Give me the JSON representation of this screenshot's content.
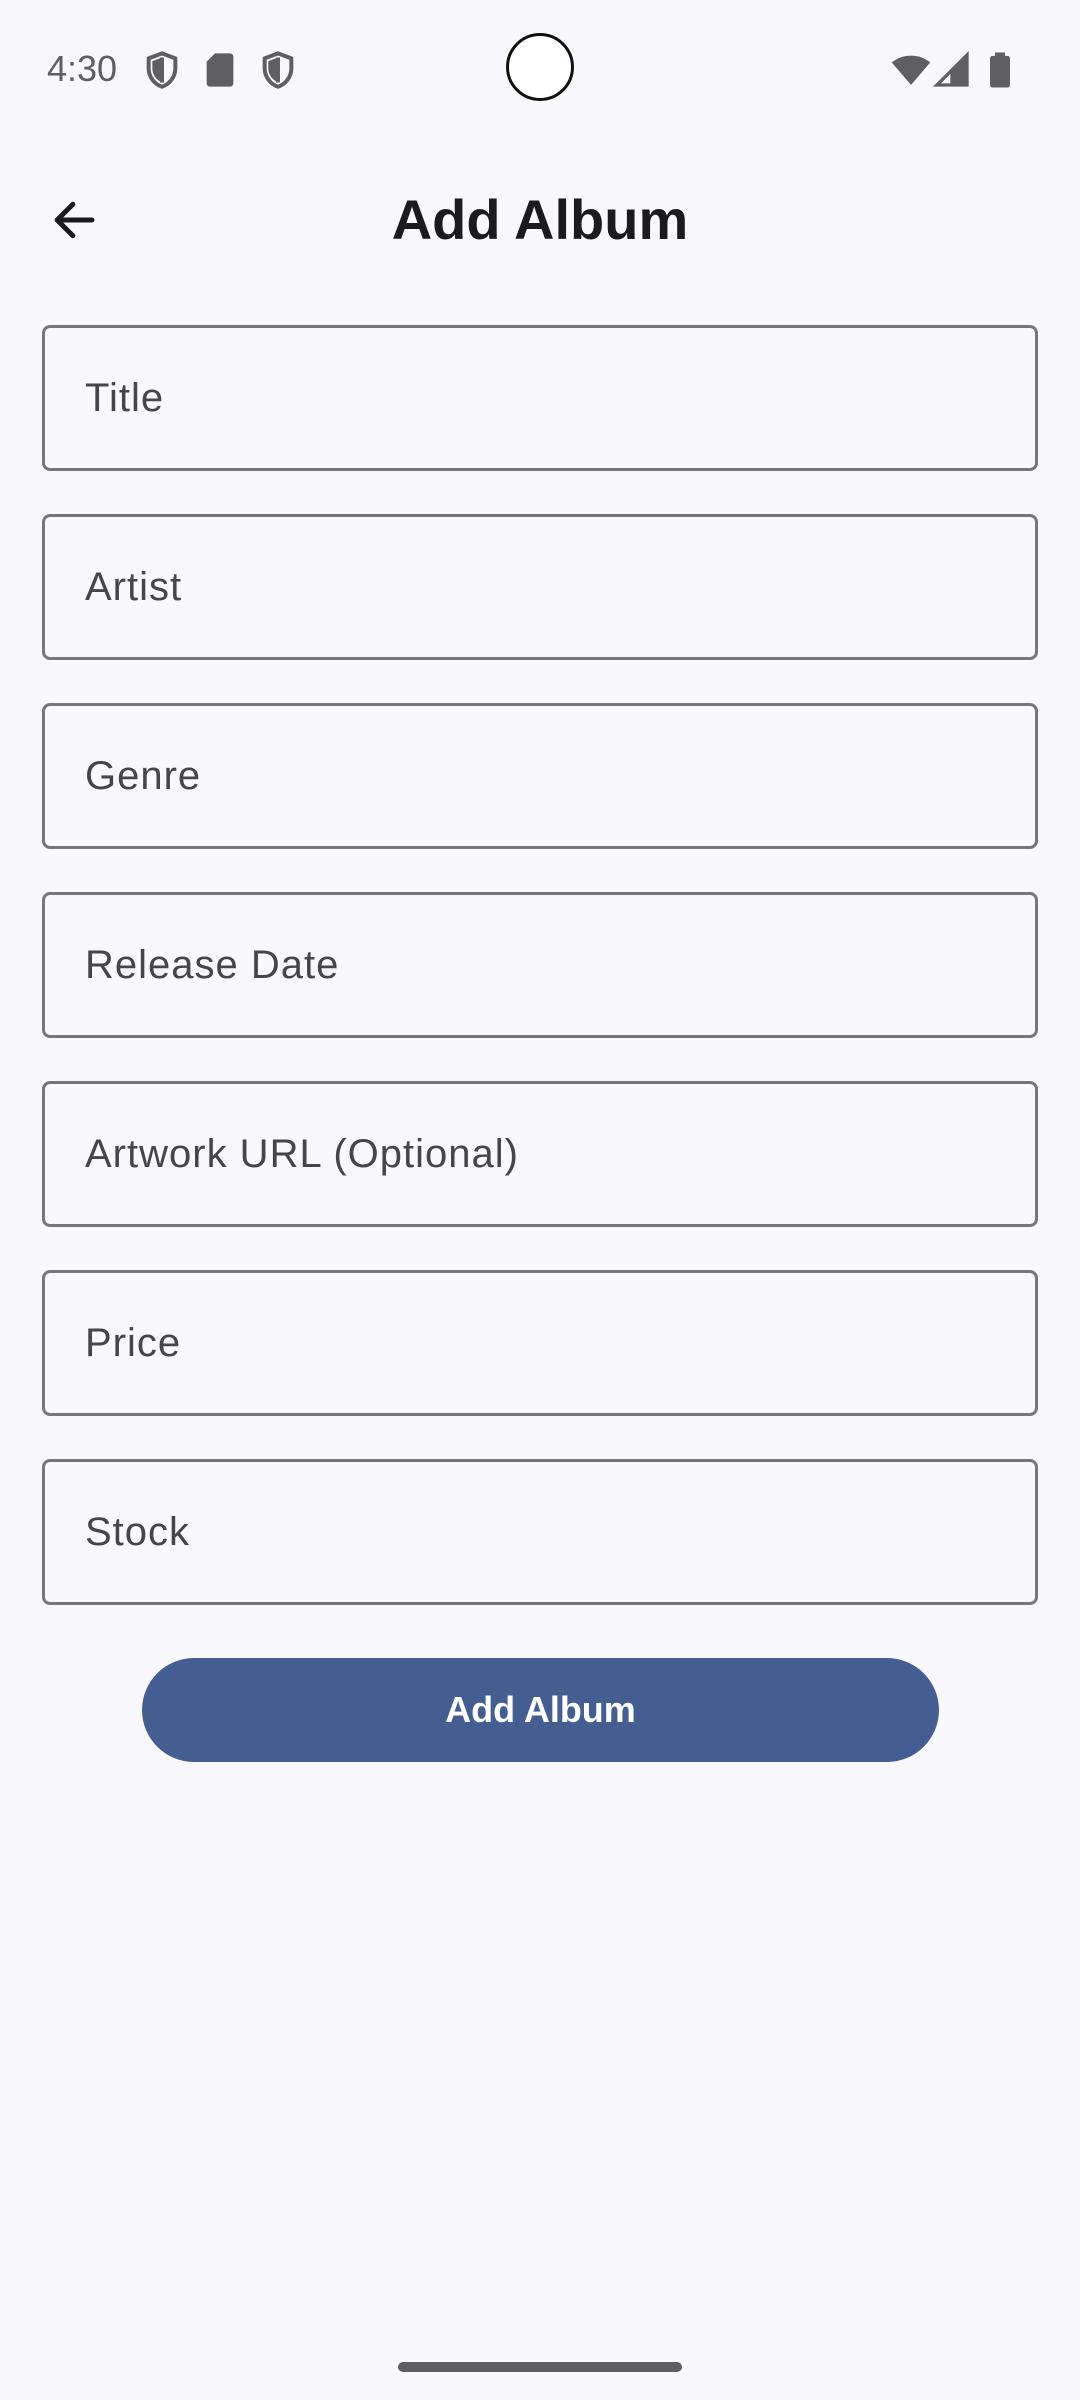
{
  "status_bar": {
    "time": "4:30",
    "left_icons": [
      "shield-icon",
      "sd-card-icon",
      "shield-icon"
    ],
    "right_icons": [
      "wifi-icon",
      "cellular-signal-icon",
      "battery-icon"
    ]
  },
  "top_bar": {
    "back_icon": "arrow-back-icon",
    "title": "Add Album"
  },
  "form": {
    "fields": [
      {
        "placeholder": "Title",
        "value": ""
      },
      {
        "placeholder": "Artist",
        "value": ""
      },
      {
        "placeholder": "Genre",
        "value": ""
      },
      {
        "placeholder": "Release Date",
        "value": ""
      },
      {
        "placeholder": "Artwork URL (Optional)",
        "value": ""
      },
      {
        "placeholder": "Price",
        "value": ""
      },
      {
        "placeholder": "Stock",
        "value": ""
      }
    ],
    "submit_label": "Add Album"
  },
  "colors": {
    "background": "#f9f8fc",
    "accent": "#445e91",
    "outline": "#77767a",
    "text": "#1b1b1f"
  }
}
